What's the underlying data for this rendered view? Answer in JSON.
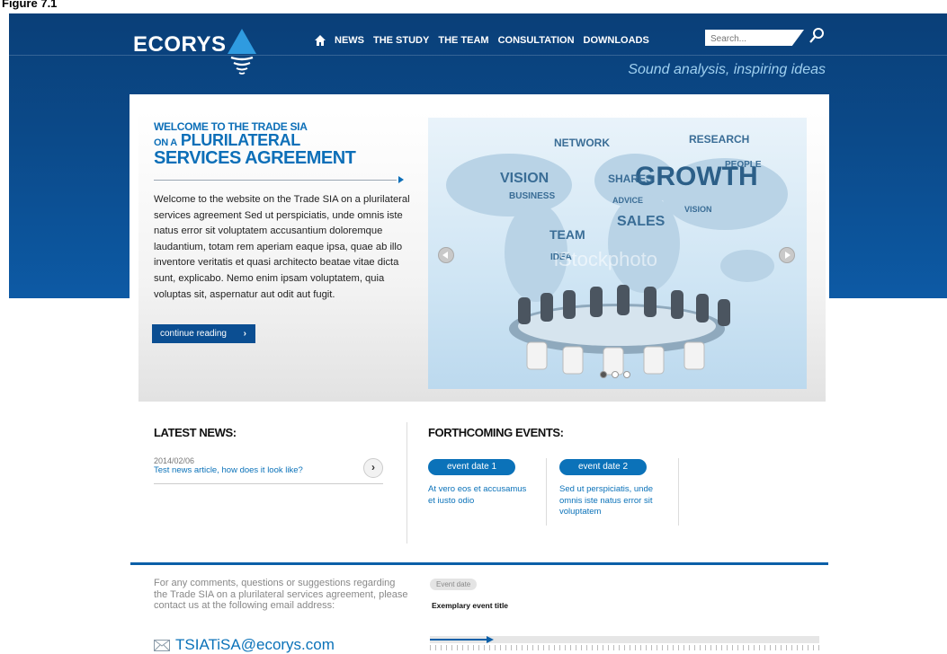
{
  "figure_label": "Figure 7.1",
  "brand": {
    "logo_text": "ECORYS",
    "tagline": "Sound analysis, inspiring ideas"
  },
  "nav": {
    "items": [
      "NEWS",
      "THE STUDY",
      "THE TEAM",
      "CONSULTATION",
      "DOWNLOADS"
    ]
  },
  "search": {
    "placeholder": "Search..."
  },
  "hero": {
    "heading_small": "WELCOME TO THE TRADE SIA",
    "heading_prefix": "ON A",
    "heading_line1": "PLURILATERAL",
    "heading_line2": "SERVICES AGREEMENT",
    "intro": "Welcome to the website on the Trade SIA on a plurilateral services agreement Sed ut perspiciatis, unde omnis iste natus error sit voluptatem accusantium doloremque laudantium, totam rem aperiam eaque ipsa, quae ab illo inventore veritatis et quasi architecto beatae vitae dicta sunt, explicabo. Nemo enim ipsam voluptatem, quia voluptas sit, aspernatur aut odit aut fugit.",
    "cta_label": "continue reading",
    "slide": {
      "words": [
        "NETWORK",
        "RESEARCH",
        "GROWTH",
        "VISION",
        "BUSINESS",
        "SHARES",
        "SALES",
        "TEAM",
        "PEOPLE",
        "IDEA",
        "ADVICE",
        "VISION"
      ],
      "watermark": "iStockphoto"
    }
  },
  "latest_news": {
    "title": "LATEST NEWS:",
    "items": [
      {
        "date": "2014/02/06",
        "headline": "Test news article, how does it look like?"
      }
    ]
  },
  "events": {
    "title": "FORTHCOMING EVENTS:",
    "items": [
      {
        "label": "event date 1",
        "text": "At vero eos et accusamus et iusto odio"
      },
      {
        "label": "event date 2",
        "text": "Sed ut perspiciatis, unde omnis iste natus error sit voluptatem"
      }
    ]
  },
  "footer": {
    "contact_text": "For any comments, questions or suggestions regarding the Trade SIA on a plurilateral services agreement, please contact us at the following email address:",
    "email": "TSIATiSA@ecorys.com",
    "event_tag": "Event date",
    "event_title": "Exemplary event title",
    "timeline_progress": 0.15
  },
  "colors": {
    "brand_blue": "#0b4a8a",
    "accent_blue": "#0b72b9",
    "tagline": "#9fd0f0"
  }
}
